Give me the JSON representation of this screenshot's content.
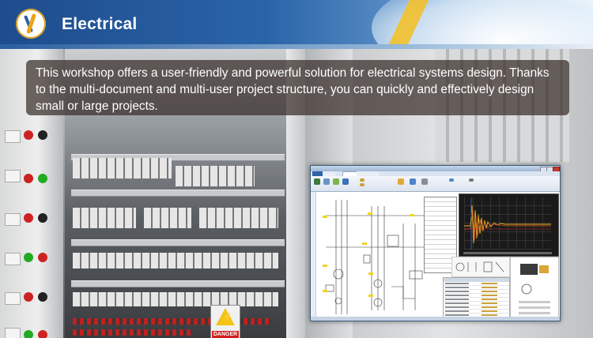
{
  "header": {
    "title": "Electrical"
  },
  "description": {
    "text": "This workshop offers a user-friendly and powerful solution for electrical systems design. Thanks to the multi-document and multi-user project structure, you can quickly and effectively design small or large projects."
  },
  "background": {
    "warning_sign_text": "DANGER"
  },
  "icons": {
    "logo": "logo-icon",
    "warning": "high-voltage-warning-icon"
  },
  "colors": {
    "header_blue": "#1e4c8c",
    "logo_gold": "#e9a417",
    "logo_blue": "#2d5fa3",
    "description_bg": "rgba(55,45,40,0.72)",
    "scope_trace": "#f2b01e"
  }
}
